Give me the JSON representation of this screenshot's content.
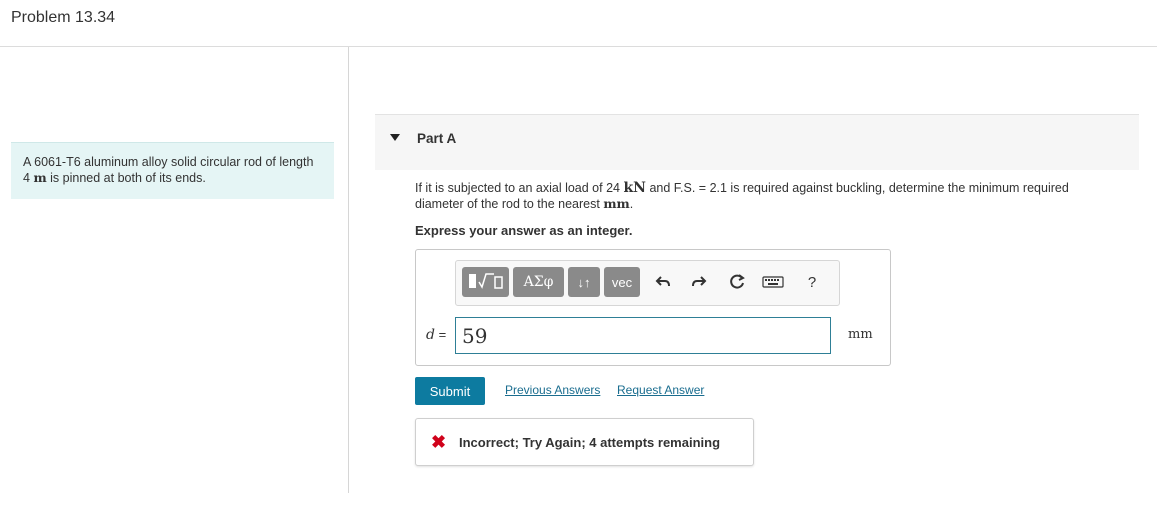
{
  "header": {
    "title": "Problem 13.34"
  },
  "problem": {
    "text_before_length": "A 6061-T6 aluminum alloy solid circular rod of length 4",
    "length_unit": "m",
    "text_after_length": "is pinned at both of its ends."
  },
  "part": {
    "label": "Part A"
  },
  "question": {
    "text1": "If it is subjected to an axial load of 24",
    "load_unit": "kN",
    "text2": "and F.S. = 2.1 is required against buckling, determine the minimum required diameter of the rod to the nearest",
    "diameter_unit": "mm",
    "text3": "."
  },
  "instruction": "Express your answer as an integer.",
  "toolbar": {
    "greek_label": "ΑΣφ",
    "arrows_label": "↓↑",
    "vec_label": "vec",
    "help_label": "?"
  },
  "answer": {
    "variable": "d",
    "equals": "=",
    "value": "59",
    "unit": "mm"
  },
  "actions": {
    "submit_label": "Submit",
    "previous_answers_label": "Previous Answers",
    "request_answer_label": "Request Answer"
  },
  "feedback": {
    "icon": "x-icon",
    "text": "Incorrect; Try Again; 4 attempts remaining"
  },
  "colors": {
    "accent": "#0d7ba0",
    "link": "#1a6d8f",
    "error": "#d0021b",
    "problem_bg": "#e5f5f5",
    "input_border": "#2e7f96"
  }
}
